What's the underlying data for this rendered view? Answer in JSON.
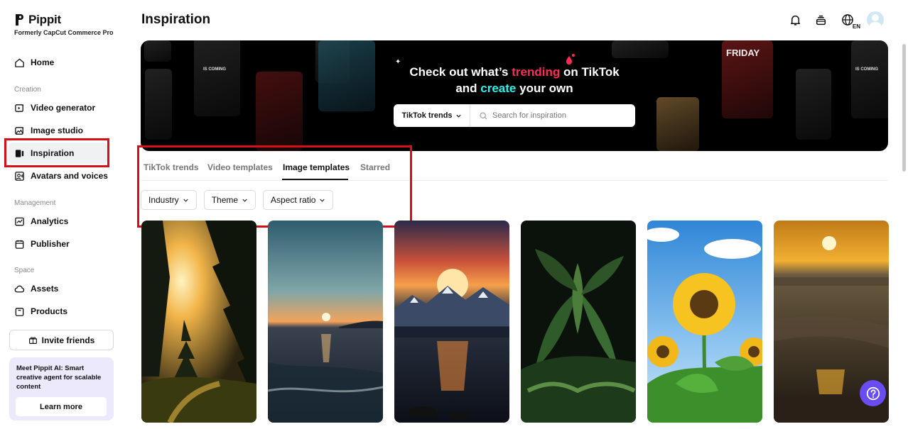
{
  "brand": {
    "name": "Pippit",
    "subtitle": "Formerly CapCut Commerce Pro"
  },
  "sidebar": {
    "home": "Home",
    "section_creation": "Creation",
    "video_generator": "Video generator",
    "image_studio": "Image studio",
    "inspiration": "Inspiration",
    "avatars": "Avatars and voices",
    "section_management": "Management",
    "analytics": "Analytics",
    "publisher": "Publisher",
    "section_space": "Space",
    "assets": "Assets",
    "products": "Products",
    "invite": "Invite friends",
    "promo_text": "Meet Pippit AI: Smart creative agent for scalable content",
    "promo_button": "Learn more"
  },
  "header": {
    "title": "Inspiration",
    "language": "EN"
  },
  "banner": {
    "line1_pre": "Check out what’s ",
    "line1_hl": "trending",
    "line1_post": " on TikTok",
    "line2_pre": "and ",
    "line2_hl": "create",
    "line2_post": " your own",
    "select_label": "TikTok trends",
    "search_placeholder": "Search for inspiration"
  },
  "tabs": [
    "TikTok trends",
    "Video templates",
    "Image templates",
    "Starred"
  ],
  "filters": [
    "Industry",
    "Theme",
    "Aspect ratio"
  ],
  "colors": {
    "accent": "#6a4cf3",
    "highlight_box": "#d40f17",
    "tiktok_pink": "#fe2c55",
    "tiktok_cyan": "#25f4ee"
  },
  "cards": [
    "forest-sunset",
    "ocean-sunset",
    "mountain-lake-sunset",
    "tropical-plants",
    "sunflowers",
    "beach-sunset"
  ]
}
